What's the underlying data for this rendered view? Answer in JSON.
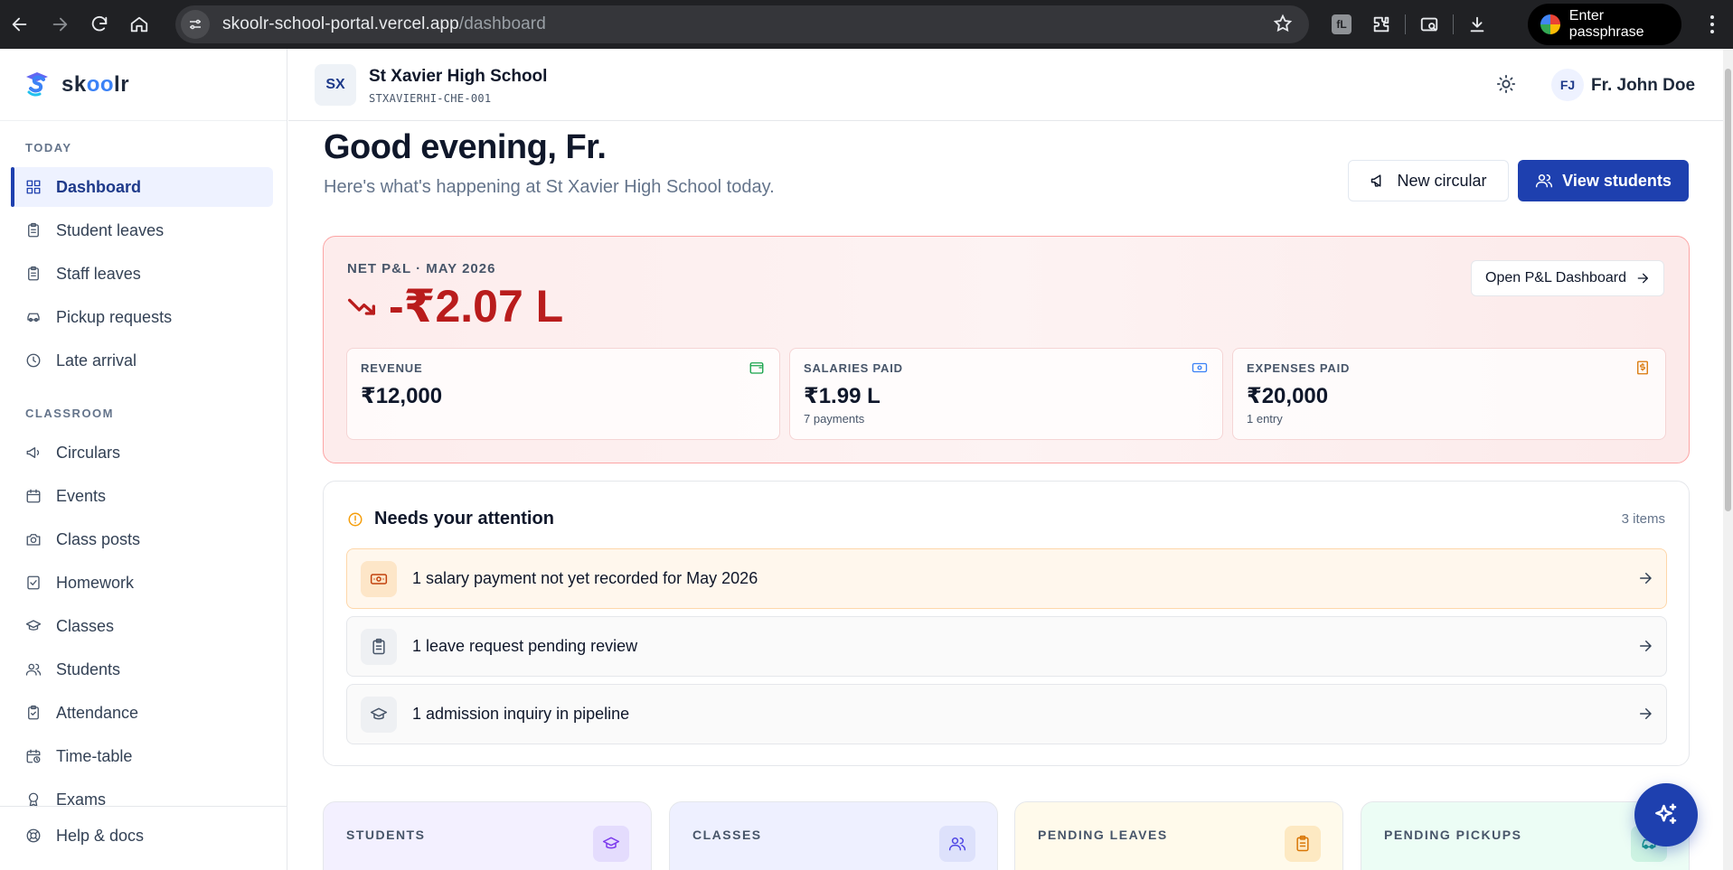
{
  "browser": {
    "url_host": "skoolr-school-portal.vercel.app",
    "url_path": "/dashboard",
    "extension_badge": "fL",
    "profile_label": "Enter passphrase"
  },
  "sidebar": {
    "brand": {
      "pre": "sk",
      "mid": "oo",
      "post": "lr"
    },
    "sections": [
      {
        "title": "TODAY"
      },
      {
        "title": "CLASSROOM"
      }
    ],
    "items": [
      {
        "label": "Dashboard",
        "icon": "dashboard-grid-icon",
        "active": true
      },
      {
        "label": "Student leaves",
        "icon": "clipboard-icon"
      },
      {
        "label": "Staff leaves",
        "icon": "clipboard-icon"
      },
      {
        "label": "Pickup requests",
        "icon": "car-icon"
      },
      {
        "label": "Late arrival",
        "icon": "clock-icon"
      },
      {
        "label": "Circulars",
        "icon": "megaphone-icon"
      },
      {
        "label": "Events",
        "icon": "calendar-icon"
      },
      {
        "label": "Class posts",
        "icon": "camera-icon"
      },
      {
        "label": "Homework",
        "icon": "checklist-icon"
      },
      {
        "label": "Classes",
        "icon": "graduation-cap-icon"
      },
      {
        "label": "Students",
        "icon": "users-icon"
      },
      {
        "label": "Attendance",
        "icon": "clipboard-check-icon"
      },
      {
        "label": "Time-table",
        "icon": "calendar-clock-icon"
      },
      {
        "label": "Exams",
        "icon": "award-icon"
      }
    ],
    "footer_item": {
      "label": "Help & docs",
      "icon": "lifebuoy-icon"
    }
  },
  "header": {
    "school_initials": "SX",
    "school_name": "St Xavier High School",
    "school_code": "STXAVIERHI-CHE-001",
    "user_initials": "FJ",
    "user_name": "Fr. John Doe"
  },
  "main": {
    "greeting": "Good evening, Fr.",
    "subtitle": "Here's what's happening at St Xavier High School today.",
    "new_circular_label": "New circular",
    "view_students_label": "View students"
  },
  "pnl": {
    "label": "NET P&L · MAY 2026",
    "value": "-₹2.07 L",
    "open_label": "Open P&L Dashboard",
    "stats": [
      {
        "label": "REVENUE",
        "value": "₹12,000",
        "sub": "",
        "icon": "wallet-icon",
        "color": "#16a34a"
      },
      {
        "label": "SALARIES PAID",
        "value": "₹1.99 L",
        "sub": "7 payments",
        "icon": "banknote-icon",
        "color": "#3b82f6"
      },
      {
        "label": "EXPENSES PAID",
        "value": "₹20,000",
        "sub": "1 entry",
        "icon": "receipt-icon",
        "color": "#d97706"
      }
    ]
  },
  "attention": {
    "title": "Needs your attention",
    "count": "3 items",
    "rows": [
      {
        "text": "1 salary payment not yet recorded for May 2026",
        "icon": "banknote-icon",
        "tone": "warn"
      },
      {
        "text": "1 leave request pending review",
        "icon": "clipboard-icon",
        "tone": "neutral"
      },
      {
        "text": "1 admission inquiry in pipeline",
        "icon": "graduation-cap-icon",
        "tone": "neutral"
      }
    ]
  },
  "kpis": [
    {
      "label": "STUDENTS",
      "icon": "graduation-cap-icon",
      "bg": "#f3f0ff",
      "icon_bg": "#e4dcfd",
      "icon_color": "#7c3aed"
    },
    {
      "label": "CLASSES",
      "icon": "users-icon",
      "bg": "#eef0ff",
      "icon_bg": "#dde1fb",
      "icon_color": "#4f46e5"
    },
    {
      "label": "PENDING LEAVES",
      "icon": "clipboard-icon",
      "bg": "#fffaeb",
      "icon_bg": "#fde9c2",
      "icon_color": "#d97706"
    },
    {
      "label": "PENDING PICKUPS",
      "icon": "car-icon",
      "bg": "#ecfdf5",
      "icon_bg": "#cdf3e2",
      "icon_color": "#0d9488"
    }
  ],
  "colors": {
    "accent": "#1e40af",
    "loss": "#b91c1c",
    "warn": "#f59e0b"
  }
}
